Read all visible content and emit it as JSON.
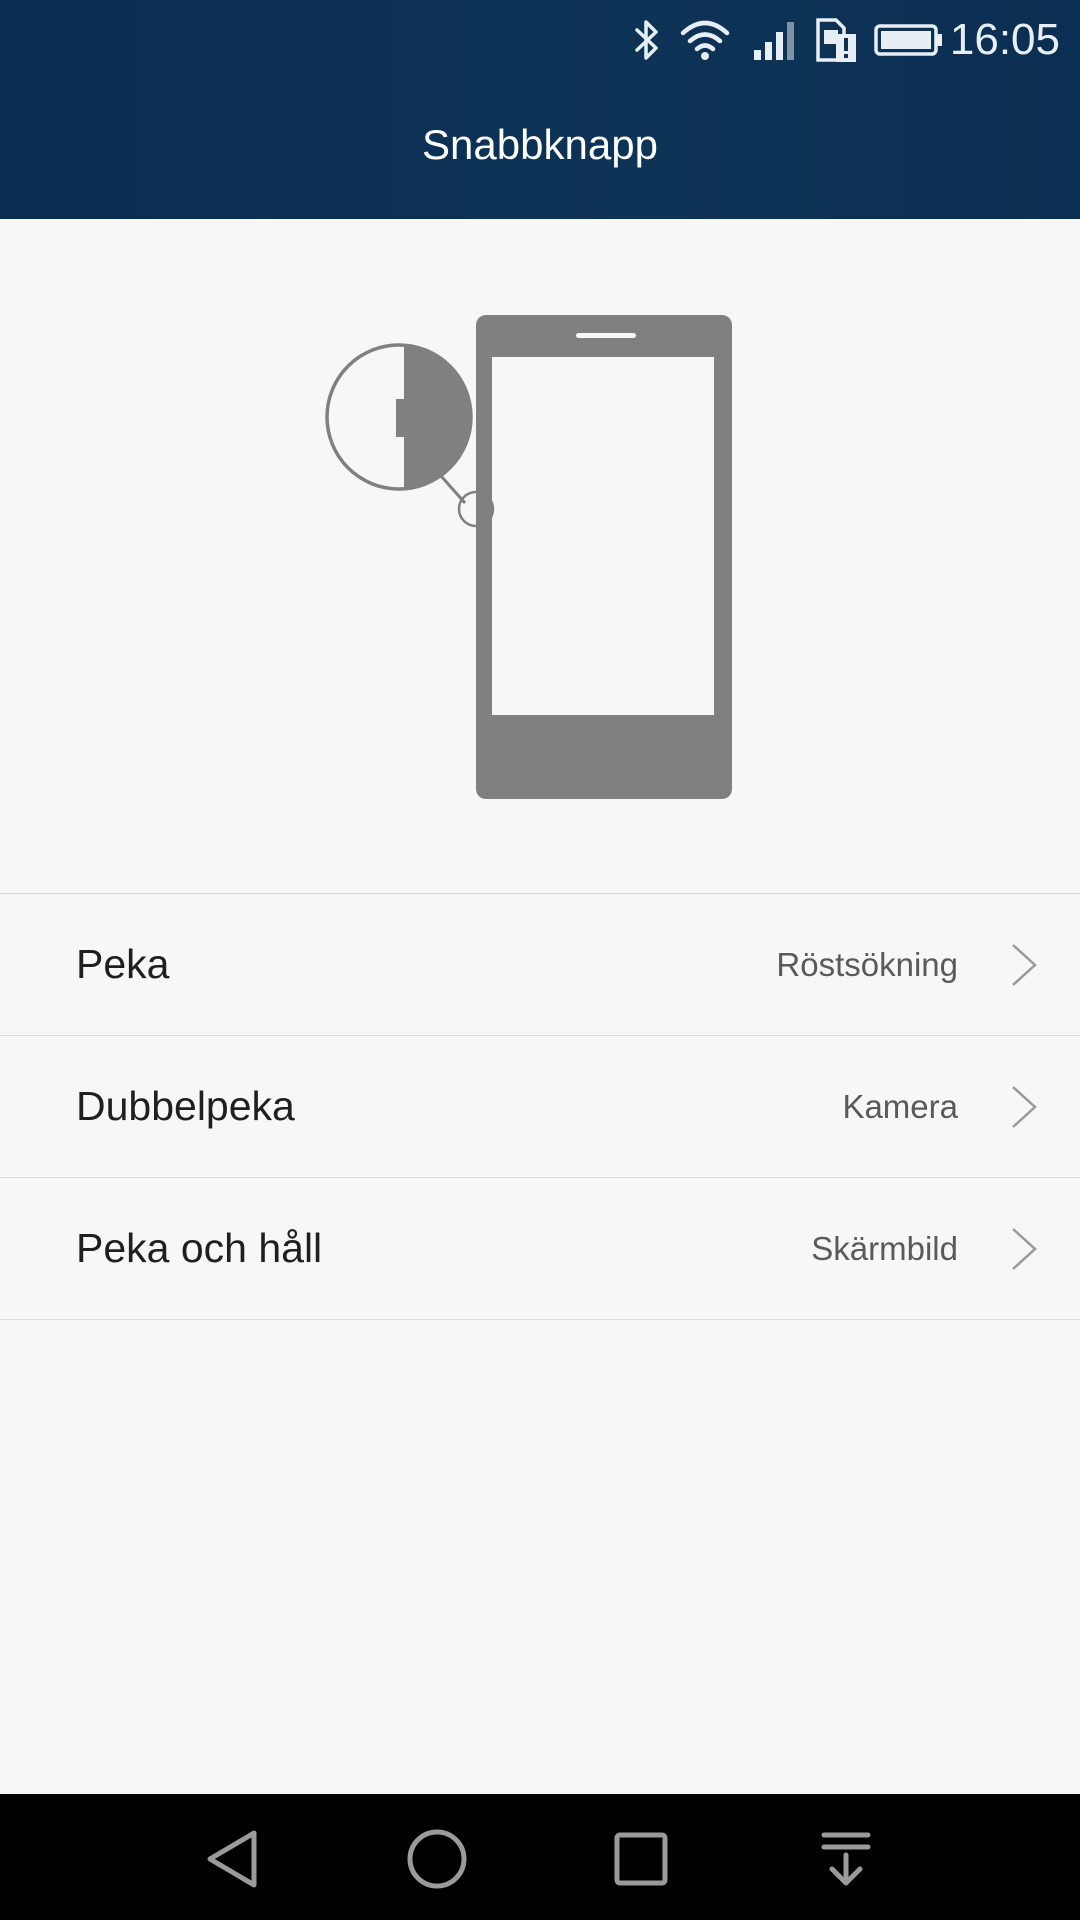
{
  "status_bar": {
    "time": "16:05",
    "icons": [
      "bluetooth-icon",
      "wifi-icon",
      "signal-icon",
      "sim-alert-icon",
      "battery-icon"
    ]
  },
  "header": {
    "title": "Snabbknapp"
  },
  "settings": [
    {
      "label": "Peka",
      "value": "Röstsökning"
    },
    {
      "label": "Dubbelpeka",
      "value": "Kamera"
    },
    {
      "label": "Peka och håll",
      "value": "Skärmbild"
    }
  ],
  "nav_bar": {
    "icons": [
      "back-icon",
      "home-icon",
      "recents-icon",
      "notification-pull-icon"
    ]
  },
  "colors": {
    "header_bg": "#0c3154",
    "page_bg": "#f7f7f7",
    "phone_gray": "#808080",
    "divider": "#dcdcdc",
    "nav_bg": "#000000"
  }
}
